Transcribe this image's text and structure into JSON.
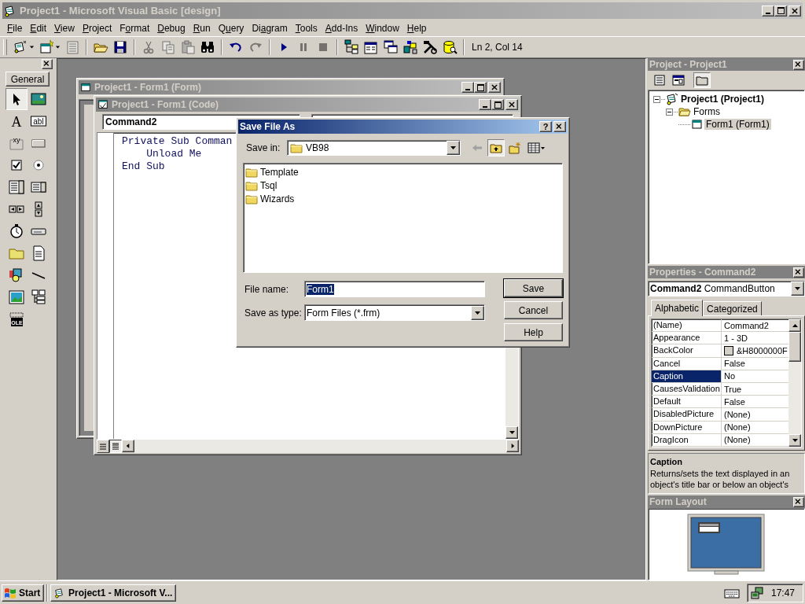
{
  "window": {
    "title": "Project1 - Microsoft Visual Basic [design]",
    "active": false
  },
  "menu": [
    {
      "key": "F",
      "post": "ile"
    },
    {
      "key": "E",
      "post": "dit"
    },
    {
      "key": "V",
      "post": "iew"
    },
    {
      "key": "P",
      "post": "roject"
    },
    {
      "pre": "F",
      "key": "o",
      "post": "rmat"
    },
    {
      "key": "D",
      "post": "ebug"
    },
    {
      "key": "R",
      "post": "un"
    },
    {
      "pre": "Q",
      "key": "u",
      "post": "ery"
    },
    {
      "pre": "Di",
      "key": "a",
      "post": "gram"
    },
    {
      "key": "T",
      "post": "ools"
    },
    {
      "key": "A",
      "post": "dd-Ins"
    },
    {
      "key": "W",
      "post": "indow"
    },
    {
      "key": "H",
      "post": "elp"
    }
  ],
  "toolbar": {
    "groups": [
      [
        {
          "kind": "add-project",
          "dropdown": true,
          "disabled": false
        },
        {
          "kind": "add-form",
          "dropdown": true,
          "disabled": false
        },
        {
          "kind": "menu-editor",
          "dropdown": false,
          "disabled": true
        }
      ],
      [
        {
          "kind": "open",
          "dropdown": false,
          "disabled": false
        },
        {
          "kind": "save",
          "dropdown": false,
          "disabled": false
        }
      ],
      [
        {
          "kind": "cut",
          "dropdown": false,
          "disabled": true
        },
        {
          "kind": "copy",
          "dropdown": false,
          "disabled": true
        },
        {
          "kind": "paste",
          "dropdown": false,
          "disabled": true
        },
        {
          "kind": "find",
          "dropdown": false,
          "disabled": false
        }
      ],
      [
        {
          "kind": "undo",
          "dropdown": false,
          "disabled": false
        },
        {
          "kind": "redo",
          "dropdown": false,
          "disabled": true
        }
      ],
      [
        {
          "kind": "start",
          "dropdown": false,
          "disabled": false
        },
        {
          "kind": "pause",
          "dropdown": false,
          "disabled": true
        },
        {
          "kind": "stop",
          "dropdown": false,
          "disabled": true
        }
      ],
      [
        {
          "kind": "project-explorer",
          "dropdown": false,
          "disabled": false
        },
        {
          "kind": "properties",
          "dropdown": false,
          "disabled": false
        },
        {
          "kind": "form-layout",
          "dropdown": false,
          "disabled": false
        },
        {
          "kind": "object-browser",
          "dropdown": false,
          "disabled": false
        },
        {
          "kind": "toolbox",
          "dropdown": false,
          "disabled": false
        },
        {
          "kind": "data-view",
          "dropdown": false,
          "disabled": false
        }
      ]
    ],
    "position": "Ln 2, Col 14"
  },
  "toolbox": {
    "title": "General",
    "tools": [
      {
        "kind": "pointer",
        "selected": true
      },
      {
        "kind": "picture",
        "selected": false
      },
      {
        "kind": "label",
        "glyph": "A",
        "selected": false
      },
      {
        "kind": "textbox",
        "glyph": "abl",
        "selected": false
      },
      {
        "kind": "frame",
        "glyph": "xy",
        "selected": false
      },
      {
        "kind": "button",
        "selected": false
      },
      {
        "kind": "checkbox",
        "selected": false
      },
      {
        "kind": "option",
        "selected": false
      },
      {
        "kind": "combo",
        "selected": false
      },
      {
        "kind": "list",
        "selected": false
      },
      {
        "kind": "hscroll",
        "selected": false
      },
      {
        "kind": "vscroll",
        "selected": false
      },
      {
        "kind": "timer",
        "selected": false
      },
      {
        "kind": "drive",
        "selected": false
      },
      {
        "kind": "dir",
        "selected": false
      },
      {
        "kind": "file",
        "selected": false
      },
      {
        "kind": "shape",
        "selected": false
      },
      {
        "kind": "line",
        "selected": false
      },
      {
        "kind": "image",
        "selected": false
      },
      {
        "kind": "data",
        "selected": false
      },
      {
        "kind": "ole",
        "glyph": "OLE",
        "selected": false
      }
    ]
  },
  "form_window": {
    "title": "Project1 - Form1 (Form)",
    "active": false
  },
  "code_window": {
    "title": "Project1 - Form1 (Code)",
    "active": false,
    "object": "Command2",
    "lines": [
      "Private Sub Comman",
      "    Unload Me",
      "End Sub"
    ]
  },
  "save_dialog": {
    "title": "Save File As",
    "active": true,
    "help_glyph": "?",
    "save_in_label": "Save in:",
    "save_in": "VB98",
    "files": [
      {
        "name": "Template",
        "selected": false
      },
      {
        "name": "Tsql",
        "selected": false
      },
      {
        "name": "Wizards",
        "selected": false
      }
    ],
    "file_name_label": "File name:",
    "file_name": "Form1",
    "file_name_selected": true,
    "type_label": "Save as type:",
    "type": "Form Files (*.frm)",
    "buttons": [
      {
        "label": "Save",
        "default": true
      },
      {
        "label": "Cancel",
        "default": false
      },
      {
        "label": "Help",
        "default": false
      }
    ]
  },
  "project": {
    "title": "Project - Project1",
    "tools": [
      {
        "kind": "view-code",
        "pressed": false
      },
      {
        "kind": "view-object",
        "pressed": false
      },
      {
        "kind": "toggle-folders",
        "pressed": true
      }
    ],
    "tree": [
      {
        "label": "Project1 (Project1)",
        "kind": "project",
        "expanded": true,
        "selected": false,
        "children": [
          {
            "label": "Forms",
            "kind": "folder",
            "expanded": true,
            "selected": false,
            "children": [
              {
                "label": "Form1 (Form1)",
                "kind": "form",
                "selected": true
              }
            ]
          }
        ]
      }
    ]
  },
  "properties": {
    "title": "Properties - Command2",
    "object_name": "Command2",
    "object_type": "CommandButton",
    "tabs": [
      {
        "label": "Alphabetic",
        "selected": true
      },
      {
        "label": "Categorized",
        "selected": false
      }
    ],
    "rows": [
      {
        "name": "(Name)",
        "value": "Command2",
        "selected": false
      },
      {
        "name": "Appearance",
        "value": "1 - 3D",
        "selected": false
      },
      {
        "name": "BackColor",
        "value": "&H8000000F",
        "color": "#d4d0c8",
        "selected": false
      },
      {
        "name": "Cancel",
        "value": "False",
        "selected": false
      },
      {
        "name": "Caption",
        "value": "No",
        "selected": true
      },
      {
        "name": "CausesValidation",
        "value": "True",
        "selected": false
      },
      {
        "name": "Default",
        "value": "False",
        "selected": false
      },
      {
        "name": "DisabledPicture",
        "value": "(None)",
        "selected": false
      },
      {
        "name": "DownPicture",
        "value": "(None)",
        "selected": false
      },
      {
        "name": "DragIcon",
        "value": "(None)",
        "selected": false
      }
    ],
    "description_title": "Caption",
    "description": "Returns/sets the text displayed in an object's title bar or below an object's"
  },
  "form_layout": {
    "title": "Form Layout"
  },
  "taskbar": {
    "start": "Start",
    "tasks": [
      {
        "label": "Project1 - Microsoft V...",
        "selected": false
      }
    ],
    "clock": "17:47"
  }
}
